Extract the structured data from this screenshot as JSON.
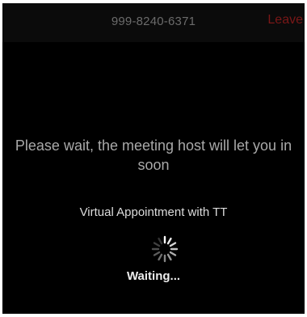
{
  "top_bar": {
    "meeting_id": "999-8240-6371",
    "leave_label": "Leave"
  },
  "main": {
    "message": "Please wait, the meeting host will let you in soon",
    "appointment_title": "Virtual Appointment with TT",
    "status_label": "Waiting..."
  },
  "icons": {
    "spinner": "loading-spinner-icon"
  },
  "colors": {
    "background": "#000000",
    "leave_accent": "#7a1717"
  }
}
